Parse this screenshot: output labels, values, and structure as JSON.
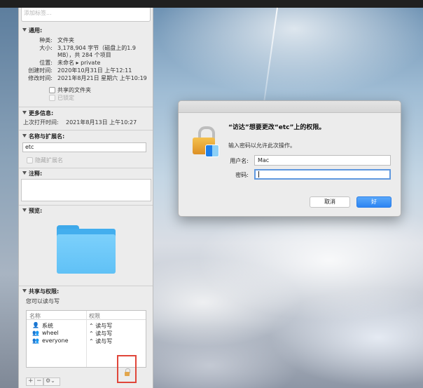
{
  "info_panel": {
    "tags_placeholder": "添加标签...",
    "general": {
      "header": "通用:",
      "kind_label": "种类:",
      "kind_value": "文件夹",
      "size_label": "大小:",
      "size_value_line1": "3,178,904 字节（磁盘上的1.9",
      "size_value_line2": "MB），共 284 个项目",
      "where_label": "位置:",
      "where_value": "未命名 ▸ private",
      "created_label": "创建时间:",
      "created_value": "2020年10月31日 上午12:11",
      "modified_label": "修改时间:",
      "modified_value": "2021年8月21日 星期六 上午10:19",
      "shared_folder_label": "共享的文件夹",
      "locked_label": "已锁定"
    },
    "more_info": {
      "header": "更多信息:",
      "last_opened_label": "上次打开时间:",
      "last_opened_value": "2021年8月13日 上午10:27"
    },
    "name_ext": {
      "header": "名称与扩展名:",
      "name_value": "etc",
      "hide_ext_label": "隐藏扩展名"
    },
    "comments": {
      "header": "注释:"
    },
    "preview": {
      "header": "预览:"
    },
    "sharing": {
      "header": "共享与权限:",
      "summary": "您可以读与写",
      "col_name": "名称",
      "col_privilege": "权限",
      "rows": [
        {
          "icon": "👤",
          "name": "系统",
          "privilege": "⌃ 读与写"
        },
        {
          "icon": "👥",
          "name": "wheel",
          "privilege": "⌃ 读与写"
        },
        {
          "icon": "👥",
          "name": "everyone",
          "privilege": "⌃ 读与写"
        }
      ],
      "add_symbol": "+",
      "remove_symbol": "−",
      "action_symbol": "⚙⌄"
    }
  },
  "dialog": {
    "title": "“访达”想要更改“etc”上的权限。",
    "message": "输入密码以允许此次操作。",
    "username_label": "用户名:",
    "username_value": "Mac",
    "password_label": "密码:",
    "password_value": "",
    "cancel_label": "取消",
    "ok_label": "好"
  },
  "colors": {
    "accent": "#2c84f2",
    "highlight_box": "#e0463a"
  }
}
